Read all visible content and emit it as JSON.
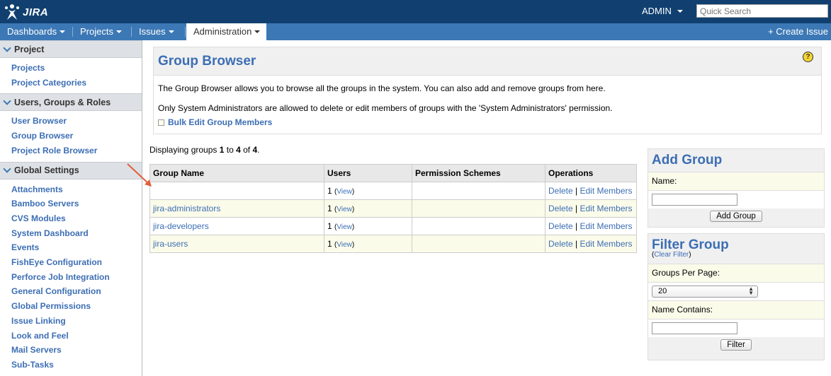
{
  "header": {
    "logo_text": "JIRA",
    "user": "ADMIN",
    "search_placeholder": "Quick Search",
    "create_issue": "Create Issue"
  },
  "nav": {
    "items": [
      "Dashboards",
      "Projects",
      "Issues",
      "Administration"
    ],
    "active": "Administration"
  },
  "sidebar": {
    "sections": [
      {
        "title": "Project",
        "items": [
          "Projects",
          "Project Categories"
        ]
      },
      {
        "title": "Users, Groups & Roles",
        "items": [
          "User Browser",
          "Group Browser",
          "Project Role Browser"
        ]
      },
      {
        "title": "Global Settings",
        "items": [
          "Attachments",
          "Bamboo Servers",
          "CVS Modules",
          "System Dashboard",
          "Events",
          "FishEye Configuration",
          "Perforce Job Integration",
          "General Configuration",
          "Global Permissions",
          "Issue Linking",
          "Look and Feel",
          "Mail Servers",
          "Sub-Tasks"
        ]
      }
    ]
  },
  "main": {
    "title": "Group Browser",
    "help": "?",
    "desc1": "The Group Browser allows you to browse all the groups in the system. You can also add and remove groups from here.",
    "desc2": "Only System Administrators are allowed to delete or edit members of groups with the 'System Administrators' permission.",
    "bulk_link": "Bulk Edit Group Members",
    "displaying": {
      "prefix": "Displaying groups ",
      "from": "1",
      "mid": " to ",
      "to": "4",
      "of_text": " of ",
      "total": "4",
      "end": "."
    },
    "table": {
      "headers": [
        "Group Name",
        "Users",
        "Permission Schemes",
        "Operations"
      ],
      "rows": [
        {
          "name": "",
          "users": "1",
          "view": "View",
          "delete": "Delete",
          "sep": "|",
          "edit": "Edit Members"
        },
        {
          "name": "jira-administrators",
          "users": "1",
          "view": "View",
          "delete": "Delete",
          "sep": "|",
          "edit": "Edit Members"
        },
        {
          "name": "jira-developers",
          "users": "1",
          "view": "View",
          "delete": "Delete",
          "sep": "|",
          "edit": "Edit Members"
        },
        {
          "name": "jira-users",
          "users": "1",
          "view": "View",
          "delete": "Delete",
          "sep": "|",
          "edit": "Edit Members"
        }
      ]
    }
  },
  "add_group": {
    "title": "Add Group",
    "name_label": "Name:",
    "button": "Add Group"
  },
  "filter_group": {
    "title": "Filter Group",
    "clear": "Clear Filter",
    "per_page_label": "Groups Per Page:",
    "per_page_value": "20",
    "name_contains_label": "Name Contains:",
    "button": "Filter"
  }
}
